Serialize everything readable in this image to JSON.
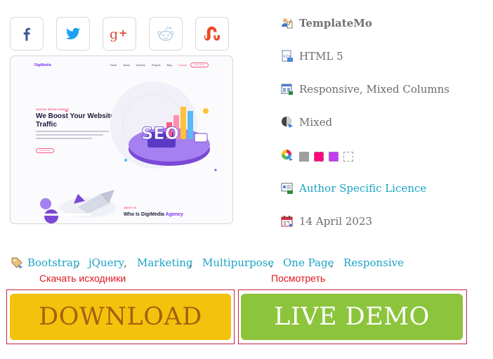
{
  "share": [
    {
      "name": "facebook",
      "color": "#3b5998"
    },
    {
      "name": "twitter",
      "color": "#1da1f2"
    },
    {
      "name": "google-plus",
      "color": "#dd4b39"
    },
    {
      "name": "reddit",
      "color": "#bcd3e6"
    },
    {
      "name": "stumbleupon",
      "color": "#eb4924"
    }
  ],
  "preview": {
    "logo": "DigiMedia",
    "nav": [
      "Home",
      "About",
      "Services",
      "Projects",
      "Blog",
      "Contact"
    ],
    "nav_button": "Free Quote",
    "sub_heading": "DIGITAL MEDIA AGENCY",
    "heading_line1": "We Boost Your Website",
    "heading_line2": "Traffic",
    "button": "Free Quote",
    "badge": "SEO",
    "about_sub": "ABOUT US",
    "about_title_plain": "Who Is DigiMedia ",
    "about_title_accent": "Agency"
  },
  "meta": {
    "author": "TemplateMo",
    "html_version": "HTML 5",
    "layout": "Responsive, Mixed Columns",
    "style": "Mixed",
    "colors": [
      "#a0a0a0",
      "#ff0a7e",
      "#c23cf0",
      "#ffffff"
    ],
    "license": "Author Specific Licence",
    "date": "14 April 2023"
  },
  "tags": [
    "Bootstrap",
    "jQuery",
    "Marketing",
    "Multipurpose",
    "One Page",
    "Responsive"
  ],
  "tag_separator": ",",
  "notes": {
    "download": "Скачать исходники",
    "demo": "Посмотреть"
  },
  "buttons": {
    "download": "DOWNLOAD",
    "demo": "LIVE DEMO"
  }
}
